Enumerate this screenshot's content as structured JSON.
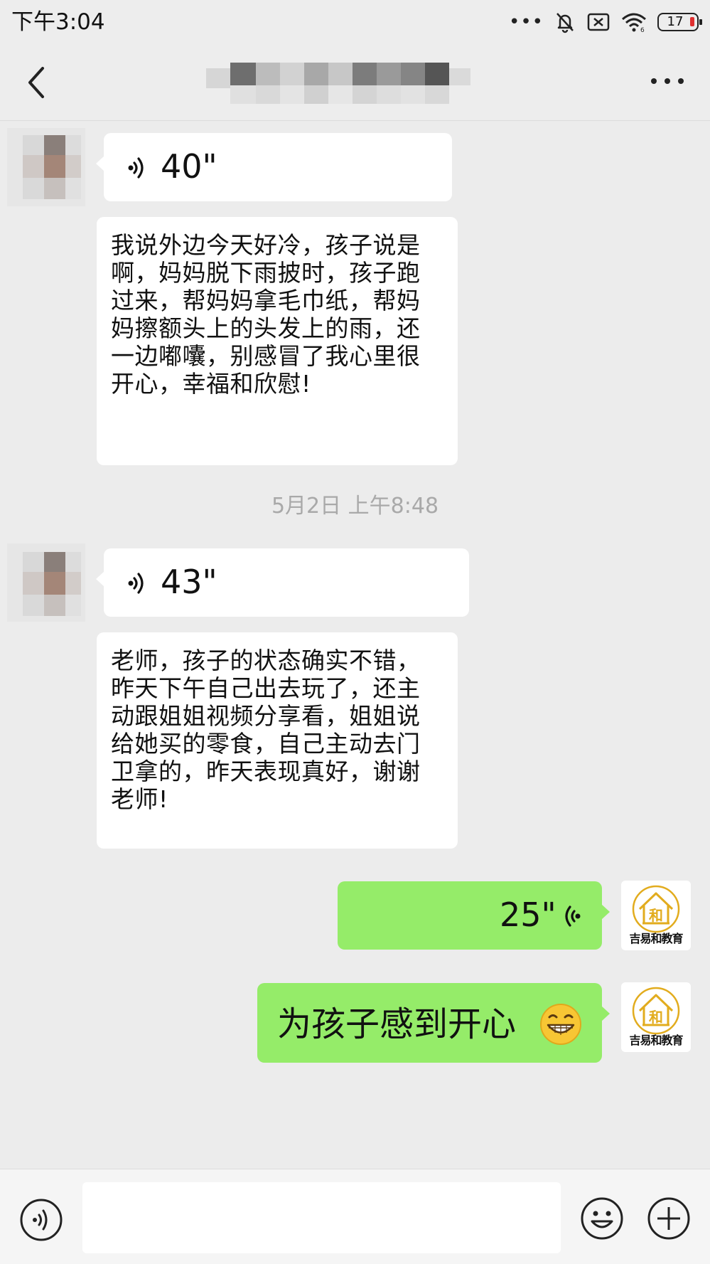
{
  "status_bar": {
    "time": "下午3:04",
    "dots": "•••",
    "battery_level": "17",
    "icons": [
      "notifications-off-icon",
      "sim-off-icon",
      "wifi-icon",
      "battery-icon"
    ]
  },
  "nav": {
    "back_icon": "chevron-left-icon",
    "title_redacted": true,
    "more_icon": "more-horizontal-icon"
  },
  "messages": [
    {
      "direction": "in",
      "type": "voice",
      "duration": "40\""
    },
    {
      "direction": "in",
      "type": "text",
      "text": "我说外边今天好冷，孩子说是啊，妈妈脱下雨披时，孩子跑过来，帮妈妈拿毛巾纸，帮妈妈擦额头上的头发上的雨，还一边嘟囔，别感冒了我心里很开心，幸福和欣慰!"
    },
    {
      "direction": "in",
      "type": "voice",
      "duration": "43\""
    },
    {
      "direction": "in",
      "type": "text",
      "text": "老师，孩子的状态确实不错，昨天下午自己出去玩了，还主动跟姐姐视频分享看，姐姐说给她买的零食，自己主动去门卫拿的，昨天表现真好，谢谢老师!"
    },
    {
      "direction": "out",
      "type": "voice",
      "duration": "25\""
    },
    {
      "direction": "out",
      "type": "text",
      "text": "为孩子感到开心",
      "emoji": "grinning-face-icon"
    }
  ],
  "timestamp": "5月2日  上午8:48",
  "brand": {
    "avatar_text": "吉易和教育"
  },
  "input_bar": {
    "voice_icon": "voice-input-icon",
    "emoji_icon": "emoji-icon",
    "plus_icon": "plus-icon",
    "placeholder": ""
  },
  "colors": {
    "background": "#ececec",
    "bubble_in": "#ffffff",
    "bubble_out": "#95ec69",
    "timestamp": "#a9a9a9",
    "brand_gold": "#e2ac1e"
  }
}
